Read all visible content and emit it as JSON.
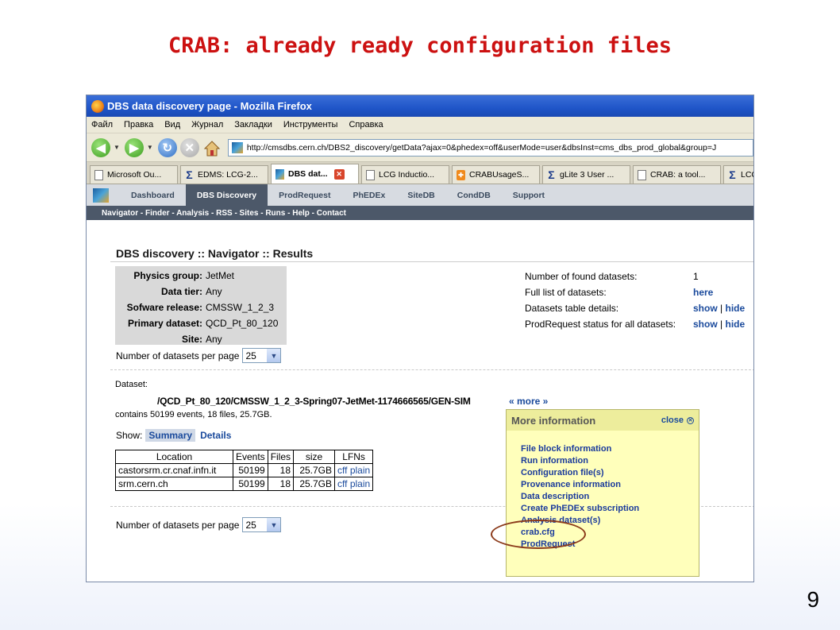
{
  "slide": {
    "title": "CRAB: already ready configuration files",
    "page_number": "9"
  },
  "browser": {
    "window_title": "DBS data discovery page - Mozilla Firefox",
    "menu": [
      "Файл",
      "Правка",
      "Вид",
      "Журнал",
      "Закладки",
      "Инструменты",
      "Справка"
    ],
    "url": "http://cmsdbs.cern.ch/DBS2_discovery/getData?ajax=0&phedex=off&userMode=user&dbsInst=cms_dbs_prod_global&group=J",
    "tabs": [
      {
        "label": "Microsoft Ou...",
        "icon": "document-icon"
      },
      {
        "label": "EDMS: LCG-2...",
        "icon": "sigma-icon"
      },
      {
        "label": "DBS dat...",
        "icon": "dbs-icon",
        "active": true
      },
      {
        "label": "LCG Inductio...",
        "icon": "document-icon"
      },
      {
        "label": "CRABUsageS...",
        "icon": "orange-icon"
      },
      {
        "label": "gLite 3 User ...",
        "icon": "sigma-icon"
      },
      {
        "label": "CRAB: a tool...",
        "icon": "document-icon"
      },
      {
        "label": "LCG",
        "icon": "sigma-icon"
      }
    ]
  },
  "site_nav": {
    "items": [
      "Dashboard",
      "DBS Discovery",
      "ProdRequest",
      "PhEDEx",
      "SiteDB",
      "CondDB",
      "Support"
    ],
    "active": "DBS Discovery",
    "subnav": "Navigator - Finder - Analysis - RSS - Sites - Runs - Help - Contact"
  },
  "results": {
    "heading": "DBS discovery :: Navigator :: Results",
    "params": [
      {
        "label": "Physics group:",
        "value": "JetMet"
      },
      {
        "label": "Data tier:",
        "value": "Any"
      },
      {
        "label": "Sofware release:",
        "value": "CMSSW_1_2_3"
      },
      {
        "label": "Primary dataset:",
        "value": "QCD_Pt_80_120"
      },
      {
        "label": "Site:",
        "value": "Any"
      }
    ],
    "per_page_label": "Number of datasets per page",
    "per_page_value": "25",
    "stats": {
      "found_label": "Number of found datasets:",
      "found_value": "1",
      "full_list_label": "Full list of datasets:",
      "full_list_link": "here",
      "table_details_label": "Datasets table details:",
      "prodrequest_label": "ProdRequest status for all datasets:",
      "show": "show",
      "sep": "|",
      "hide": "hide"
    },
    "dataset": {
      "label": "Dataset:",
      "name": "/QCD_Pt_80_120/CMSSW_1_2_3-Spring07-JetMet-1174666565/GEN-SIM",
      "more": "« more »",
      "contains": "contains 50199 events, 18 files, 25.7GB.",
      "show_label": "Show:",
      "summary": "Summary",
      "details": "Details"
    },
    "table": {
      "headers": [
        "Location",
        "Events",
        "Files",
        "size",
        "LFNs"
      ],
      "rows": [
        {
          "location": "castorsrm.cr.cnaf.infn.it",
          "events": "50199",
          "files": "18",
          "size": "25.7GB",
          "lfns": "cff plain"
        },
        {
          "location": "srm.cern.ch",
          "events": "50199",
          "files": "18",
          "size": "25.7GB",
          "lfns": "cff plain"
        }
      ]
    }
  },
  "popup": {
    "title": "More information",
    "close": "close",
    "items": [
      "File block information",
      "Run information",
      "Configuration file(s)",
      "Provenance information",
      "Data description",
      "Create PhEDEx subscription",
      "Analysis dataset(s)",
      "crab.cfg",
      "ProdRequest"
    ]
  },
  "colors": {
    "title_red": "#cc1111",
    "link_blue": "#1a4a9c",
    "popup_bg": "#ffffbb",
    "highlight": "#8b3a1a"
  }
}
